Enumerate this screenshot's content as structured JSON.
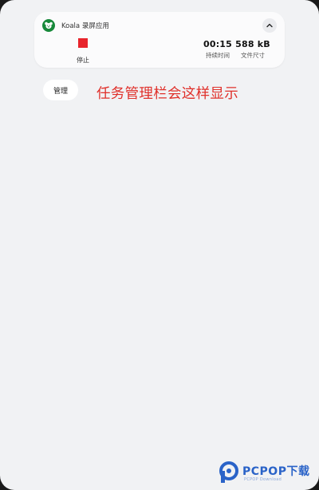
{
  "notification": {
    "app_name": "Koala 录屏应用",
    "stop_label": "停止",
    "duration_value": "00:15",
    "duration_label": "持续时间",
    "size_value": "588 kB",
    "size_label": "文件尺寸",
    "icons": {
      "app": "koala-app-icon",
      "collapse": "chevron-up-icon",
      "stop": "stop-icon"
    }
  },
  "manage_button_label": "管理",
  "annotation": "任务管理栏会这样显示",
  "watermark": {
    "brand": "PCPOP下载",
    "sub": "PCPOP Download"
  },
  "colors": {
    "stop_red": "#e8242c",
    "annotation_red": "#e0302a",
    "app_green": "#17893a",
    "watermark_blue": "#2a63c8",
    "background": "#f1f2f4"
  }
}
